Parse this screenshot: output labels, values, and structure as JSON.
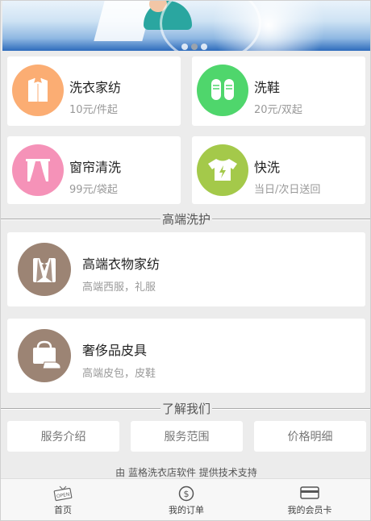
{
  "services": [
    {
      "title": "洗衣家纺",
      "sub": "10元/件起",
      "color": "#fbad73",
      "icon": "shirt-icon"
    },
    {
      "title": "洗鞋",
      "sub": "20元/双起",
      "color": "#4fd66c",
      "icon": "sneakers-icon"
    },
    {
      "title": "窗帘清洗",
      "sub": "99元/袋起",
      "color": "#f592b8",
      "icon": "curtain-icon"
    },
    {
      "title": "快洗",
      "sub": "当日/次日送回",
      "color": "#a4c94a",
      "icon": "fast-wash-shirt-icon"
    }
  ],
  "premium_section": {
    "title": "高端洗护",
    "items": [
      {
        "title": "高端衣物家纺",
        "sub": "高端西服，礼服",
        "color": "#9c8474",
        "icon": "tuxedo-icon"
      },
      {
        "title": "奢侈品皮具",
        "sub": "高端皮包，皮鞋",
        "color": "#9c8474",
        "icon": "handbag-shoe-icon"
      }
    ]
  },
  "about_section": {
    "title": "了解我们",
    "buttons": [
      "服务介绍",
      "服务范围",
      "价格明细"
    ]
  },
  "footer_text": "由 蓝格洗衣店软件 提供技术支持",
  "tabbar": [
    {
      "label": "首页",
      "icon": "open-sign-icon"
    },
    {
      "label": "我的订单",
      "icon": "dollar-coin-icon"
    },
    {
      "label": "我的会员卡",
      "icon": "card-icon"
    }
  ]
}
